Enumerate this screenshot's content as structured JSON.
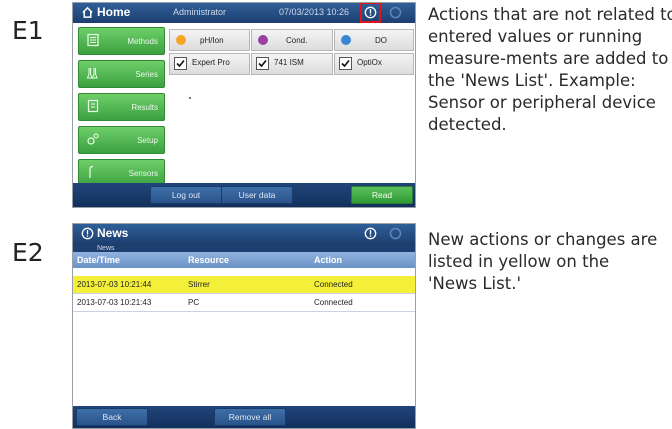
{
  "steps": [
    {
      "label": "E1",
      "description": "Actions that are not related to entered values or running measure-ments are added to the 'News List'. Example: Sensor or peripheral device detected."
    },
    {
      "label": "E2",
      "description": "New actions or changes are listed in yellow on the 'News List.'"
    }
  ],
  "screen1": {
    "title": "Home",
    "user": "Administrator",
    "datetime": "07/03/2013 10:26",
    "menu": [
      "Methods",
      "Series",
      "Results",
      "Setup",
      "Sensors"
    ],
    "tiles": [
      {
        "label": "pH/Ion",
        "color": "#f5a623"
      },
      {
        "label": "Cond.",
        "color": "#9b3fa0"
      },
      {
        "label": "DO",
        "color": "#3a86d4"
      }
    ],
    "checks": [
      "Expert Pro",
      "741 ISM",
      "OptiOx"
    ],
    "buttons": {
      "logout": "Log out",
      "userdata": "User data",
      "read": "Read"
    },
    "highlight_color": "#e0151b"
  },
  "screen2": {
    "title": "News",
    "breadcrumb": "News",
    "columns": [
      "Date/Time",
      "Resource",
      "Action"
    ],
    "rows": [
      {
        "datetime": "2013-07-03 10:21:44",
        "resource": "Stirrer",
        "action": "Connected",
        "highlight": true
      },
      {
        "datetime": "2013-07-03 10:21:43",
        "resource": "PC",
        "action": "Connected",
        "highlight": false
      }
    ],
    "buttons": {
      "back": "Back",
      "removeall": "Remove all"
    },
    "highlight_color": "#f4f03a"
  }
}
